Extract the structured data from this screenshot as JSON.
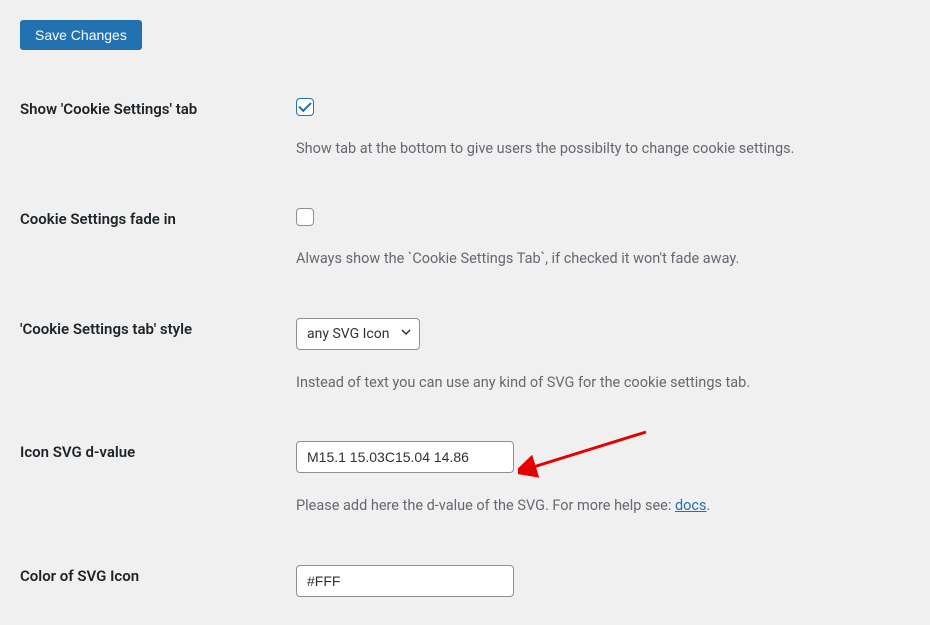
{
  "save_button_label": "Save Changes",
  "fields": {
    "show_tab": {
      "label": "Show 'Cookie Settings' tab",
      "description": "Show tab at the bottom to give users the possibilty to change cookie settings."
    },
    "fade_in": {
      "label": "Cookie Settings fade in",
      "description": "Always show the `Cookie Settings Tab`, if checked it won't fade away."
    },
    "tab_style": {
      "label": "'Cookie Settings tab' style",
      "selected": "any SVG Icon",
      "description": "Instead of text you can use any kind of SVG for the cookie settings tab."
    },
    "svg_d": {
      "label": "Icon SVG d-value",
      "value": "M15.1 15.03C15.04 14.86",
      "description_prefix": "Please add here the d-value of the SVG. For more help see: ",
      "link_text": "docs",
      "description_suffix": "."
    },
    "svg_color": {
      "label": "Color of SVG Icon",
      "value": "#FFF"
    }
  }
}
